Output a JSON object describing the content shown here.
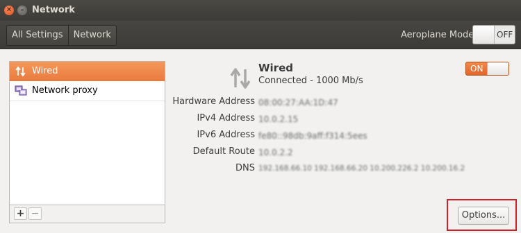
{
  "window": {
    "title": "Network"
  },
  "toolbar": {
    "breadcrumbs": [
      "All Settings",
      "Network"
    ],
    "aeroplane_label": "Aeroplane Mode",
    "aeroplane_state": "OFF"
  },
  "sidebar": {
    "items": [
      {
        "label": "Wired",
        "icon": "wired-arrows-icon",
        "selected": true
      },
      {
        "label": "Network proxy",
        "icon": "network-proxy-icon",
        "selected": false
      }
    ],
    "add_label": "+",
    "remove_label": "−"
  },
  "device": {
    "name": "Wired",
    "status": "Connected - 1000 Mb/s",
    "switch_state": "ON",
    "details": [
      {
        "label": "Hardware Address",
        "value": "08:00:27:AA:1D:47"
      },
      {
        "label": "IPv4 Address",
        "value": "10.0.2.15"
      },
      {
        "label": "IPv6 Address",
        "value": "fe80::98db:9aff:f314:5ees"
      },
      {
        "label": "Default Route",
        "value": "10.0.2.2"
      },
      {
        "label": "DNS",
        "value": "192.168.66.10 192.168.66.20 10.200.226.2 10.200.16.2"
      }
    ]
  },
  "footer": {
    "options_label": "Options..."
  },
  "colors": {
    "accent": "#f07c3e",
    "highlight": "#cc2127",
    "titlebar": "#3c3b37"
  }
}
